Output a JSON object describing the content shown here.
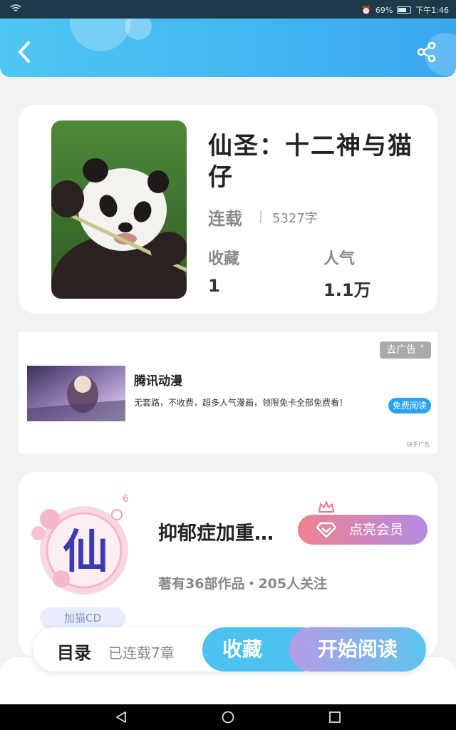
{
  "status_bar": {
    "battery_percent": "69%",
    "time": "下午1:46"
  },
  "header": {
    "back_icon": "chevron-left-icon",
    "share_icon": "share-icon"
  },
  "book": {
    "title": "仙圣：十二神与猫仔",
    "status": "连载",
    "word_count": "5327字",
    "favorites_label": "收藏",
    "favorites_value": "1",
    "popularity_label": "人气",
    "popularity_value": "1.1万"
  },
  "ad": {
    "close_label": "去广告",
    "title": "腾讯动漫",
    "description": "无套路，不收费，超多人气漫画，领限免卡全部免费看！",
    "button_label": "免费阅读",
    "source": "快手广告"
  },
  "author": {
    "avatar_text": "仙",
    "level_badge": "6",
    "tag": "加猫CD",
    "name": "抑郁症加重…",
    "vip_button": "点亮会员",
    "stats": "著有36部作品・205人关注"
  },
  "bottom_bar": {
    "toc_label": "目录",
    "chapters_text": "已连载7章",
    "favorite_button": "收藏",
    "read_button": "开始阅读"
  },
  "colors": {
    "accent": "#3aa8f0",
    "vip_gradient_start": "#f0818f",
    "vip_gradient_end": "#b48ce3"
  }
}
